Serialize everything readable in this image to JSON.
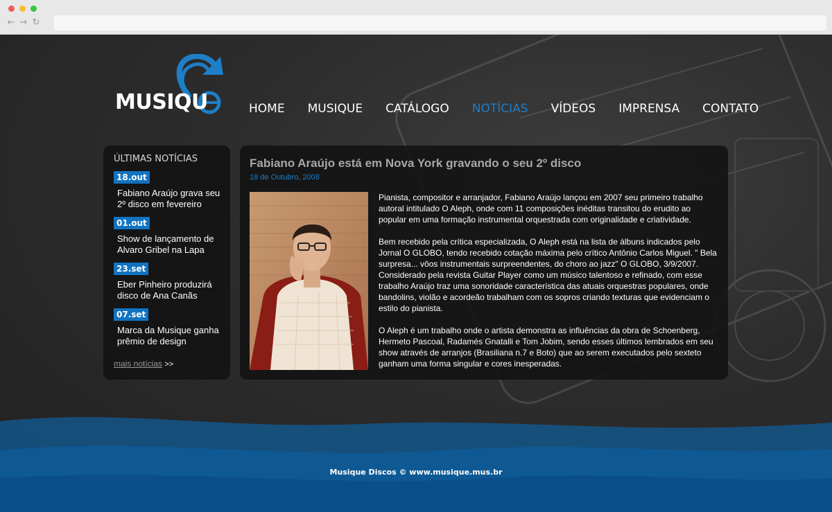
{
  "browser": {
    "back_icon": "←",
    "forward_icon": "→",
    "reload_icon": "↻"
  },
  "logo": {
    "text": "MUSIQU",
    "brand_color": "#1d7fc8"
  },
  "nav": {
    "items": [
      {
        "label": "HOME"
      },
      {
        "label": "MUSIQUE"
      },
      {
        "label": "CATÁLOGO"
      },
      {
        "label": "NOTÍCIAS"
      },
      {
        "label": "VÍDEOS"
      },
      {
        "label": "IMPRENSA"
      },
      {
        "label": "CONTATO"
      }
    ],
    "active_color": "#1d7fc8"
  },
  "sidebar": {
    "title": "ÚLTIMAS NOTÍCIAS",
    "items": [
      {
        "date": "18.out",
        "text": "Fabiano Araújo grava seu 2º disco em fevereiro"
      },
      {
        "date": "01.out",
        "text": "Show de lançamento de Alvaro Gribel na Lapa"
      },
      {
        "date": "23.set",
        "text": "Eber Pinheiro produzirá disco de  Ana Canãs"
      },
      {
        "date": "07.set",
        "text": "Marca da Musique ganha prêmio de design"
      }
    ],
    "more_label": "mais notícias",
    "more_arrow": ">>"
  },
  "article": {
    "title": "Fabiano Araújo está em Nova York gravando o seu 2º disco",
    "date": "18 de Outubro, 2008",
    "paragraphs": [
      "Pianista, compositor e arranjador, Fabiano Araújo lançou em 2007 seu primeiro trabalho autoral intitulado O Aleph, onde com 11 composições inéditas transitou do erudito ao popular em uma formação instrumental orquestrada com originalidade e criatividade.",
      "Bem recebido pela crítica especializada, O Aleph está na lista de álbuns indicados pelo Jornal O GLOBO, tendo recebido cotação máxima pelo crítico Antônio Carlos Miguel. \" Bela surpresa... vôos instrumentais surpreendentes, do choro ao jazz\" O GLOBO, 3/9/2007. Considerado pela revista Guitar Player como um músico talentoso e refinado, com esse trabalho Araújo traz uma sonoridade característica das atuais orquestras populares, onde bandolins, violão e acordeão trabalham com os sopros criando texturas que evidenciam o estilo do pianista.",
      "O Aleph é um trabalho onde o artista demonstra as influências da obra de Schoenberg, Hermeto Pascoal, Radamés Gnatalli e Tom Jobim, sendo esses últimos lembrados em seu show através de arranjos (Brasiliana n.7 e Boto) que ao serem executados pelo sexteto ganham uma forma singular e cores inesperadas."
    ]
  },
  "footer": {
    "text": "Musique Discos © www.musique.mus.br"
  }
}
